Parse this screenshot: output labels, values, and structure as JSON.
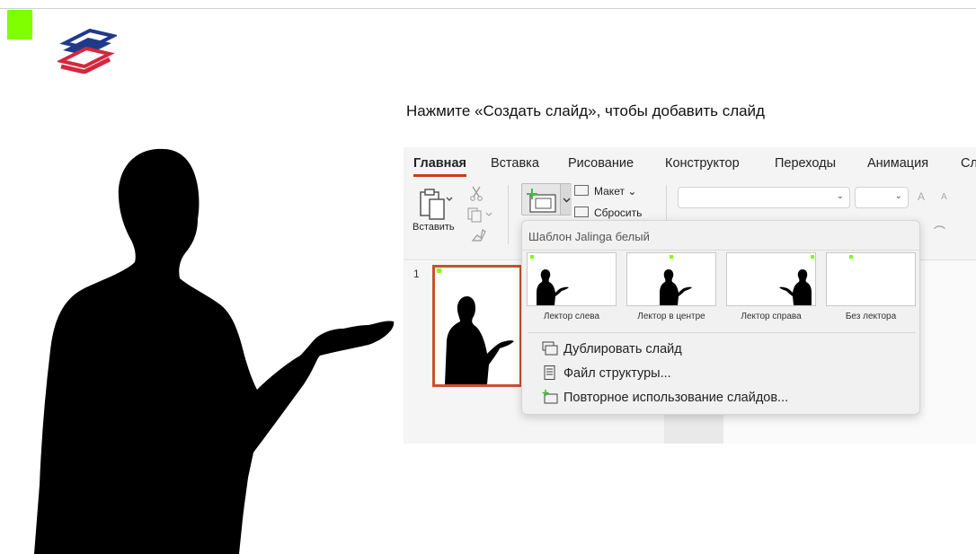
{
  "instruction": "Нажмите «Создать слайд», чтобы добавить слайд",
  "colors": {
    "accent_green": "#7fff00",
    "tab_accent": "#c43e1c",
    "logo_blue": "#1f3a8a",
    "logo_red": "#d7263d"
  },
  "ribbon": {
    "tabs": [
      {
        "label": "Главная",
        "active": true
      },
      {
        "label": "Вставка"
      },
      {
        "label": "Рисование"
      },
      {
        "label": "Конструктор"
      },
      {
        "label": "Переходы"
      },
      {
        "label": "Анимация"
      },
      {
        "label": "Сл"
      }
    ],
    "paste_label": "Вставить",
    "layout_label": "Макет",
    "reset_label": "Сбросить",
    "grow_font": "A",
    "shrink_font": "A"
  },
  "thumbnails": {
    "slide_number": "1"
  },
  "new_slide_menu": {
    "header": "Шаблон Jalinga белый",
    "layouts": [
      {
        "name": "Лектор слева"
      },
      {
        "name": "Лектор в центре"
      },
      {
        "name": "Лектор справа"
      },
      {
        "name": "Без лектора"
      }
    ],
    "actions": [
      {
        "label": "Дублировать слайд",
        "icon": "duplicate-slide-icon"
      },
      {
        "label": "Файл структуры...",
        "icon": "outline-file-icon"
      },
      {
        "label": "Повторное использование слайдов...",
        "icon": "reuse-slides-icon"
      }
    ]
  }
}
